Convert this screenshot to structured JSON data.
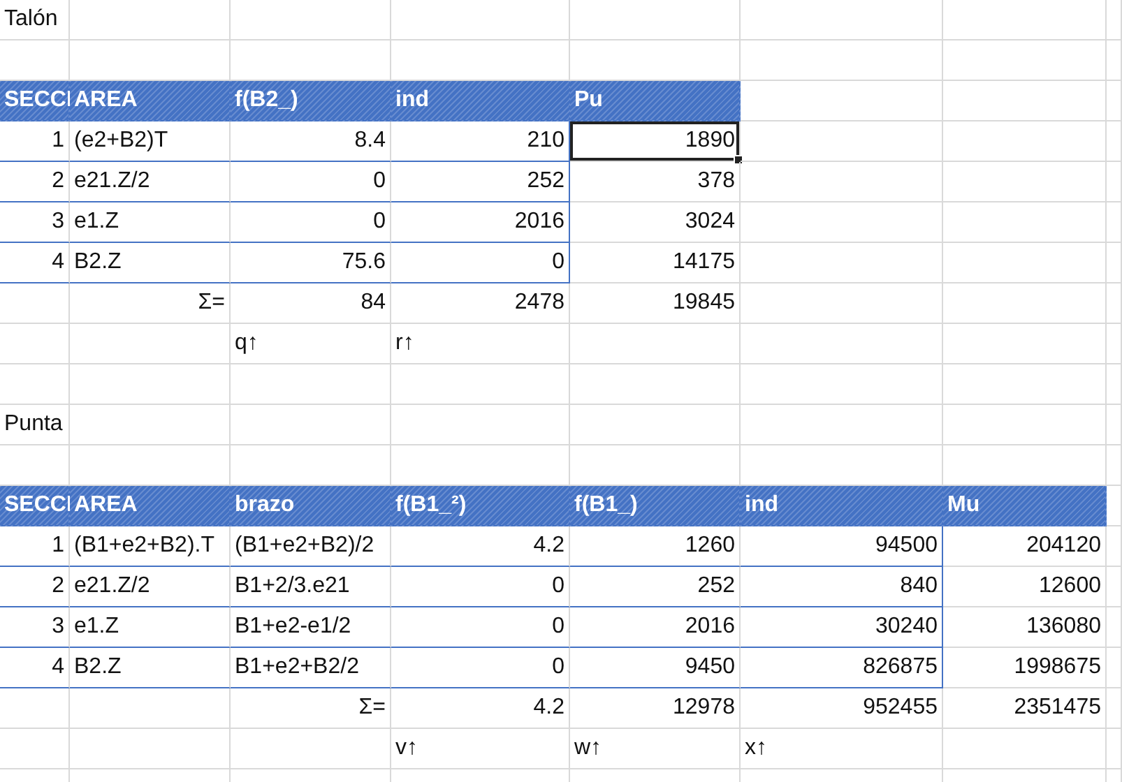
{
  "sections": [
    {
      "title": "Talón",
      "columns": [
        "SECCI",
        "AREA",
        "f(B2_)",
        "ind",
        "Pu"
      ],
      "rows": [
        {
          "cells": [
            {
              "text": "1",
              "selected": false
            },
            {
              "text": "(e2+B2)T",
              "selected": false
            },
            {
              "text": "8.4",
              "selected": false
            },
            {
              "text": "210",
              "selected": false
            },
            {
              "text": "1890",
              "selected": true
            }
          ]
        },
        {
          "cells": [
            {
              "text": "2",
              "selected": false
            },
            {
              "text": "e21.Z/2",
              "selected": false
            },
            {
              "text": "0",
              "selected": false
            },
            {
              "text": "252",
              "selected": false
            },
            {
              "text": "378",
              "selected": false
            }
          ]
        },
        {
          "cells": [
            {
              "text": "3",
              "selected": false
            },
            {
              "text": "e1.Z",
              "selected": false
            },
            {
              "text": "0",
              "selected": false
            },
            {
              "text": "2016",
              "selected": false
            },
            {
              "text": "3024",
              "selected": false
            }
          ]
        },
        {
          "cells": [
            {
              "text": "4",
              "selected": false
            },
            {
              "text": "B2.Z",
              "selected": false
            },
            {
              "text": "75.6",
              "selected": false
            },
            {
              "text": "0",
              "selected": false
            },
            {
              "text": "14175",
              "selected": false
            }
          ]
        }
      ],
      "totals": {
        "label": "Σ=",
        "values": [
          "84",
          "2478",
          "19845"
        ]
      },
      "markers": [
        "q↑",
        "r↑"
      ]
    },
    {
      "title": "Punta",
      "columns": [
        "SECCI",
        "AREA",
        "brazo",
        "f(B1_²)",
        "f(B1_)",
        "ind",
        "Mu"
      ],
      "rows": [
        {
          "cells": [
            {
              "text": "1",
              "selected": false
            },
            {
              "text": "(B1+e2+B2).T",
              "selected": false
            },
            {
              "text": "(B1+e2+B2)/2",
              "selected": false
            },
            {
              "text": "4.2",
              "selected": false
            },
            {
              "text": "1260",
              "selected": false
            },
            {
              "text": "94500",
              "selected": false
            },
            {
              "text": "204120",
              "selected": false
            }
          ]
        },
        {
          "cells": [
            {
              "text": "2",
              "selected": false
            },
            {
              "text": "e21.Z/2",
              "selected": false
            },
            {
              "text": "B1+2/3.e21",
              "selected": false
            },
            {
              "text": "0",
              "selected": false
            },
            {
              "text": "252",
              "selected": false
            },
            {
              "text": "840",
              "selected": false
            },
            {
              "text": "12600",
              "selected": false
            }
          ]
        },
        {
          "cells": [
            {
              "text": "3",
              "selected": false
            },
            {
              "text": "e1.Z",
              "selected": false
            },
            {
              "text": "B1+e2-e1/2",
              "selected": false
            },
            {
              "text": "0",
              "selected": false
            },
            {
              "text": "2016",
              "selected": false
            },
            {
              "text": "30240",
              "selected": false
            },
            {
              "text": "136080",
              "selected": false
            }
          ]
        },
        {
          "cells": [
            {
              "text": "4",
              "selected": false
            },
            {
              "text": "B2.Z",
              "selected": false
            },
            {
              "text": "B1+e2+B2/2",
              "selected": false
            },
            {
              "text": "0",
              "selected": false
            },
            {
              "text": "9450",
              "selected": false
            },
            {
              "text": "826875",
              "selected": false
            },
            {
              "text": "1998675",
              "selected": false
            }
          ]
        }
      ],
      "totals": {
        "label": "Σ=",
        "values": [
          "4.2",
          "12978",
          "952455",
          "2351475"
        ]
      },
      "markers": [
        "v↑",
        "w↑",
        "x↑"
      ]
    }
  ]
}
